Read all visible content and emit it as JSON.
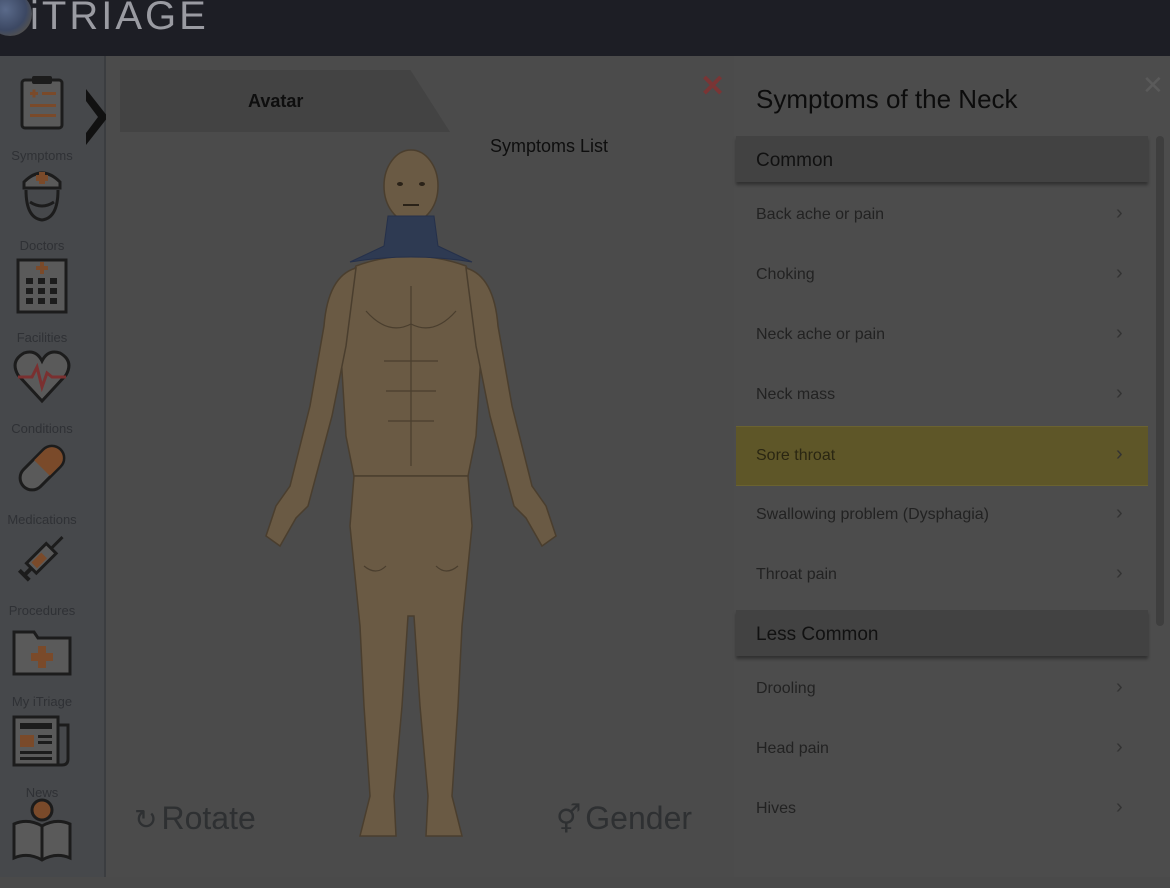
{
  "app": {
    "title": "iTRIAGE"
  },
  "sidebar": {
    "items": [
      {
        "label": "Symptoms",
        "icon": "clipboard-icon",
        "active": true
      },
      {
        "label": "Doctors",
        "icon": "doctor-icon"
      },
      {
        "label": "Facilities",
        "icon": "hospital-building-icon"
      },
      {
        "label": "Conditions",
        "icon": "heart-pulse-icon"
      },
      {
        "label": "Medications",
        "icon": "pill-icon"
      },
      {
        "label": "Procedures",
        "icon": "syringe-icon"
      },
      {
        "label": "My iTriage",
        "icon": "folder-plus-icon"
      },
      {
        "label": "News",
        "icon": "newspaper-icon"
      },
      {
        "label": "",
        "icon": "book-reader-icon"
      }
    ]
  },
  "tabs": [
    {
      "label": "Avatar",
      "active": true
    },
    {
      "label": "Symptoms List",
      "active": false
    }
  ],
  "main": {
    "close_glyph": "✕",
    "rotate_label": "Rotate",
    "gender_label": "Gender",
    "highlighted_region": "neck"
  },
  "panel": {
    "title": "Symptoms of the Neck",
    "close_glyph": "✕",
    "sections": [
      {
        "header": "Common",
        "items": [
          "Back ache or pain",
          "Choking",
          "Neck ache or pain",
          "Neck mass",
          "Sore throat",
          "Swallowing problem (Dysphagia)",
          "Throat pain"
        ],
        "selected": "Sore throat"
      },
      {
        "header": "Less Common",
        "items": [
          "Drooling",
          "Head pain",
          "Hives"
        ]
      }
    ],
    "chevron": "›"
  },
  "colors": {
    "topbar": "#1d1e25",
    "selected_row": "#5e5628",
    "neck_highlight": "#2e3a52",
    "skin": "#6a5a44"
  }
}
